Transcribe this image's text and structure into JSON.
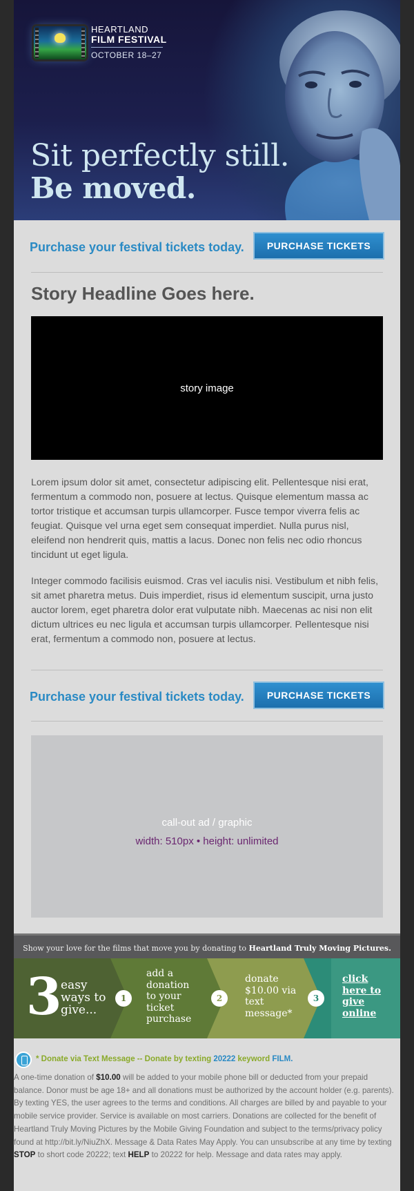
{
  "hero": {
    "logo_line1": "HEARTLAND",
    "logo_line2": "FILM FESTIVAL",
    "logo_line3": "OCTOBER 18–27",
    "tagline_1": "Sit perfectly still.",
    "tagline_2": "Be moved."
  },
  "cta": {
    "text": "Purchase your festival tickets today.",
    "button": "PURCHASE TICKETS"
  },
  "story": {
    "headline": "Story Headline Goes here.",
    "image_label": "story image",
    "paragraph_1": "Lorem ipsum dolor sit amet, consectetur adipiscing elit. Pellentesque nisi erat, fermentum a commodo non, posuere at lectus. Quisque elementum massa ac tortor tristique et accumsan turpis ullamcorper. Fusce tempor viverra felis ac feugiat. Quisque vel urna eget sem consequat imperdiet. Nulla purus nisl, eleifend non hendrerit quis, mattis a lacus. Donec non felis nec odio rhoncus tincidunt ut eget ligula.",
    "paragraph_2": "Integer commodo facilisis euismod. Cras vel iaculis nisi. Vestibulum et nibh felis, sit amet pharetra metus. Duis imperdiet, risus id elementum suscipit, urna justo auctor lorem, eget pharetra dolor erat vulputate nibh. Maecenas ac nisi non elit dictum ultrices eu nec ligula et accumsan turpis ullamcorper. Pellentesque nisi erat, fermentum a commodo non, posuere at lectus."
  },
  "callout": {
    "line1": "call-out ad / graphic",
    "line2": "width: 510px  •  height: unlimited"
  },
  "donate": {
    "bar_text": "Show your love for the films that move you by donating to",
    "bar_org": "Heartland Truly Moving Pictures.",
    "big_number": "3",
    "ways_text": "easy ways to give...",
    "steps": [
      {
        "num": "1",
        "text": "add a donation to your ticket purchase"
      },
      {
        "num": "2",
        "text": "donate $10.00 via text message*"
      },
      {
        "num": "3",
        "text": "click here to give online"
      }
    ],
    "colors": {
      "seg1": "#4e6233",
      "seg2": "#5f7a37",
      "seg3": "#8e9c4f",
      "seg4": "#1f8a7a"
    }
  },
  "sms": {
    "prefix": "* Donate via Text Message -- Donate by texting",
    "code": "20222",
    "keyword_label": "keyword",
    "keyword": "FILM."
  },
  "fine_print": {
    "t1": "A one-time donation of",
    "amount": "$10.00",
    "t2": "will be added to your mobile phone bill or deducted from your prepaid balance. Donor must be age 18+ and all donations must be authorized by the account holder (e.g. parents). By texting YES, the user agrees to the terms and conditions. All charges are billed by and payable to your mobile service provider. Service is available on most carriers. Donations are collected for the benefit of Heartland Truly Moving Pictures by the Mobile Giving Foundation and subject to the terms/privacy policy found at http://bit.ly/NiuZhX. Message & Data Rates May Apply. You can unsubscribe at any time by texting",
    "stop": "STOP",
    "t3": "to short code 20222; text",
    "help": "HELP",
    "t4": "to 20222 for help. Message and data rates may apply."
  }
}
